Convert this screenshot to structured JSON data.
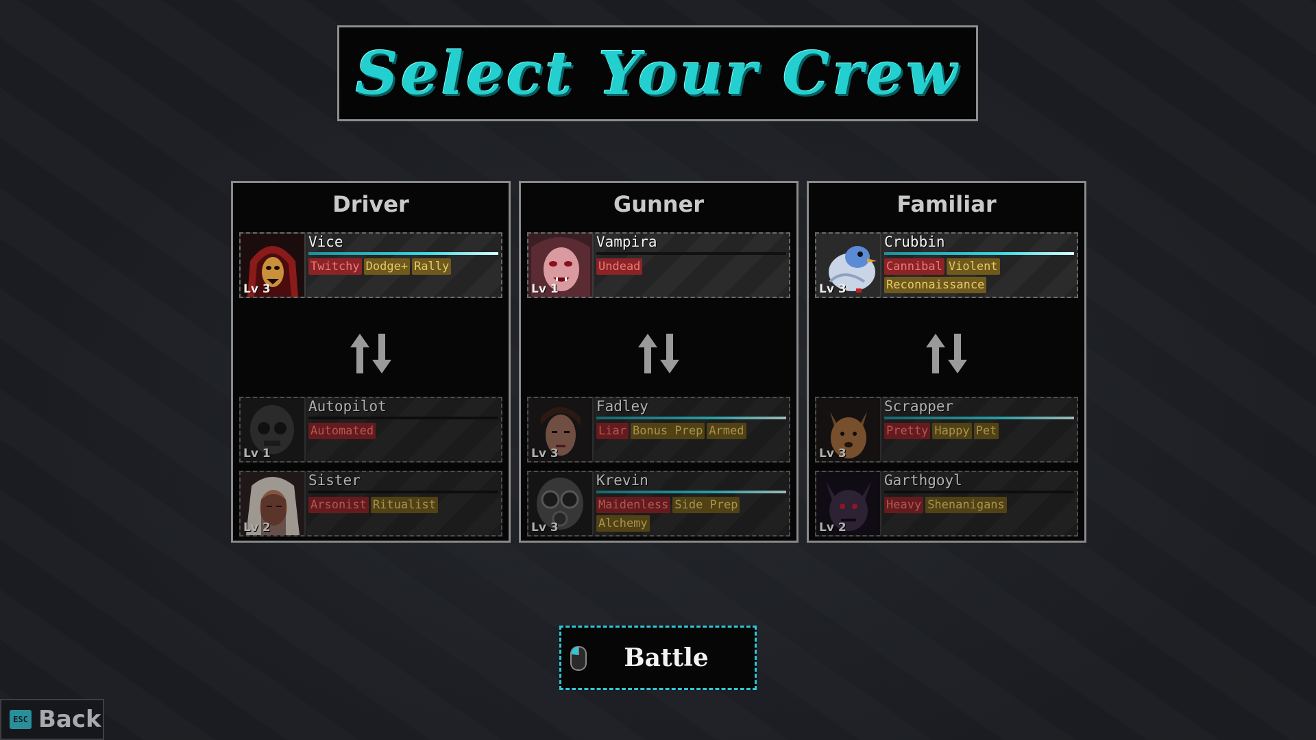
{
  "title": "Select Your Crew",
  "columns": [
    {
      "role": "Driver",
      "active": {
        "name": "Vice",
        "level": "Lv 3",
        "hp": 1.0,
        "portrait": "red-hooded-figure",
        "tags": [
          {
            "text": "Twitchy",
            "color": "red"
          },
          {
            "text": "Dodge+",
            "color": "gold"
          },
          {
            "text": "Rally",
            "color": "gold"
          }
        ]
      },
      "reserves": [
        {
          "name": "Autopilot",
          "level": "Lv 1",
          "hp": 0.0,
          "portrait": "robot-mask",
          "tags": [
            {
              "text": "Automated",
              "color": "red"
            }
          ]
        },
        {
          "name": "Sister",
          "level": "Lv 2",
          "hp": 0.0,
          "portrait": "hooded-nun",
          "tags": [
            {
              "text": "Arsonist",
              "color": "red"
            },
            {
              "text": "Ritualist",
              "color": "gold"
            }
          ]
        }
      ]
    },
    {
      "role": "Gunner",
      "active": {
        "name": "Vampira",
        "level": "Lv 1",
        "hp": 0.0,
        "portrait": "vampire-woman",
        "tags": [
          {
            "text": "Undead",
            "color": "red"
          }
        ]
      },
      "reserves": [
        {
          "name": "Fadley",
          "level": "Lv 3",
          "hp": 1.0,
          "portrait": "dark-haired-man",
          "tags": [
            {
              "text": "Liar",
              "color": "red"
            },
            {
              "text": "Bonus Prep",
              "color": "gold"
            },
            {
              "text": "Armed",
              "color": "gold"
            }
          ]
        },
        {
          "name": "Krevin",
          "level": "Lv 3",
          "hp": 1.0,
          "portrait": "gas-mask",
          "tags": [
            {
              "text": "Maidenless",
              "color": "red"
            },
            {
              "text": "Side Prep",
              "color": "gold"
            },
            {
              "text": "Alchemy",
              "color": "gold"
            }
          ]
        }
      ]
    },
    {
      "role": "Familiar",
      "active": {
        "name": "Crubbin",
        "level": "Lv 3",
        "hp": 1.0,
        "portrait": "blue-pigeon",
        "tags": [
          {
            "text": "Cannibal",
            "color": "red"
          },
          {
            "text": "Violent",
            "color": "gold"
          },
          {
            "text": "Reconnaissance",
            "color": "gold"
          }
        ]
      },
      "reserves": [
        {
          "name": "Scrapper",
          "level": "Lv 3",
          "hp": 1.0,
          "portrait": "brown-dog",
          "tags": [
            {
              "text": "Pretty",
              "color": "red"
            },
            {
              "text": "Happy",
              "color": "gold"
            },
            {
              "text": "Pet",
              "color": "gold"
            }
          ]
        },
        {
          "name": "Garthgoyl",
          "level": "Lv 2",
          "hp": 0.0,
          "portrait": "dark-gargoyle",
          "tags": [
            {
              "text": "Heavy",
              "color": "red"
            },
            {
              "text": "Shenanigans",
              "color": "gold"
            }
          ]
        }
      ]
    }
  ],
  "swap_icon": "swap-arrows-icon",
  "battle_button": {
    "label": "Battle",
    "icon": "mouse-left-click-icon"
  },
  "back_button": {
    "label": "Back",
    "key": "ESC"
  },
  "colors": {
    "accent": "#23d0cf",
    "tag_red": "#8a2428",
    "tag_gold": "#6e5a1c",
    "hp": "#35d8e2"
  }
}
